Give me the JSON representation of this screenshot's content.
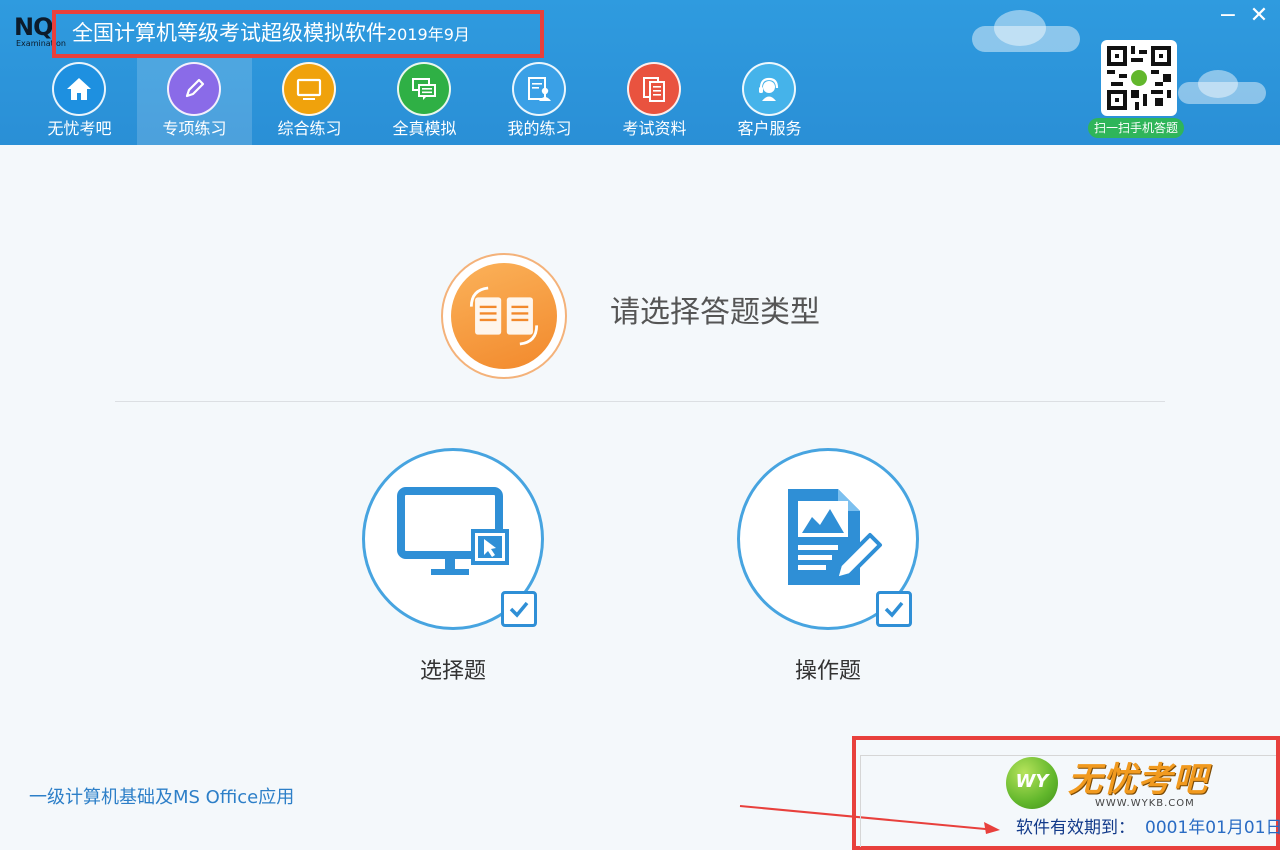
{
  "header": {
    "logo_text": "NQ",
    "logo_subtext": "Examination",
    "title": "全国计算机等级考试超级模拟软件",
    "title_suffix": "2019年9月",
    "minimize_label": "−",
    "close_label": "✕",
    "qr_label": "扫一扫手机答题"
  },
  "nav": {
    "items": [
      {
        "label": "无忧考吧",
        "icon": "home-icon",
        "color": "#1e90e0"
      },
      {
        "label": "专项练习",
        "icon": "pencil-icon",
        "color": "#8a6be8",
        "active": true
      },
      {
        "label": "综合练习",
        "icon": "monitor-icon",
        "color": "#f0a20c"
      },
      {
        "label": "全真模拟",
        "icon": "chat-icon",
        "color": "#2fb045"
      },
      {
        "label": "我的练习",
        "icon": "user-doc-icon",
        "color": "#3aa0e6"
      },
      {
        "label": "考试资料",
        "icon": "documents-icon",
        "color": "#e9533f"
      },
      {
        "label": "客户服务",
        "icon": "headset-icon",
        "color": "#45b3ea"
      }
    ]
  },
  "main": {
    "prompt": "请选择答题类型",
    "choices": [
      {
        "label": "选择题",
        "icon": "monitor-cursor-icon"
      },
      {
        "label": "操作题",
        "icon": "document-pen-icon"
      }
    ]
  },
  "footer": {
    "subject": "一级计算机基础及MS Office应用",
    "brand_logo_text": "WY",
    "brand_name": "无忧考吧",
    "brand_url": "WWW.WYKB.COM",
    "validity_label": "软件有效期到：",
    "validity_date": "0001年01月01日"
  },
  "colors": {
    "header_bg": "#2a8fd6",
    "accent_blue": "#47a4e0",
    "highlight_red": "#e8403c",
    "orange": "#f2892c"
  }
}
